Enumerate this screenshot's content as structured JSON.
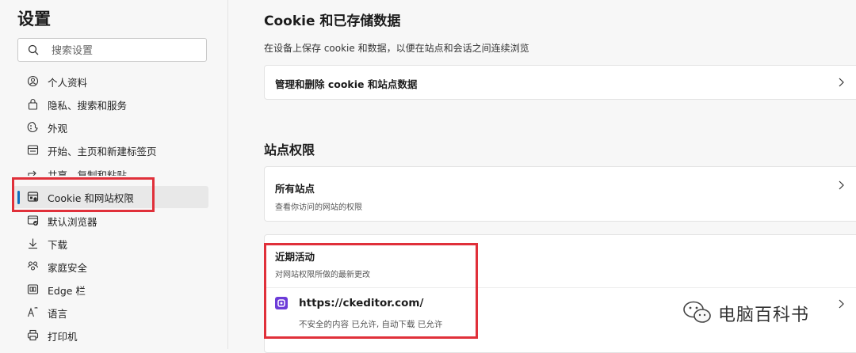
{
  "sidebar": {
    "title": "设置",
    "search_placeholder": "搜索设置",
    "items": [
      {
        "label": "个人资料",
        "icon": "profile-icon"
      },
      {
        "label": "隐私、搜索和服务",
        "icon": "lock-icon"
      },
      {
        "label": "外观",
        "icon": "appearance-icon"
      },
      {
        "label": "开始、主页和新建标签页",
        "icon": "start-page-icon"
      },
      {
        "label": "共享、复制和粘贴",
        "icon": "share-icon"
      },
      {
        "label": "Cookie 和网站权限",
        "icon": "cookie-permissions-icon",
        "active": true
      },
      {
        "label": "默认浏览器",
        "icon": "default-browser-icon"
      },
      {
        "label": "下载",
        "icon": "download-icon"
      },
      {
        "label": "家庭安全",
        "icon": "family-icon"
      },
      {
        "label": "Edge 栏",
        "icon": "edge-bar-icon"
      },
      {
        "label": "语言",
        "icon": "language-icon"
      },
      {
        "label": "打印机",
        "icon": "printer-icon"
      }
    ]
  },
  "main": {
    "cookie_section": {
      "title": "Cookie 和已存储数据",
      "description": "在设备上保存 cookie 和数据，以便在站点和会话之间连续浏览",
      "manage_label": "管理和删除 cookie 和站点数据"
    },
    "permissions_section": {
      "title": "站点权限",
      "all_sites_title": "所有站点",
      "all_sites_sub": "查看你访问的网站的权限",
      "recent_title": "近期活动",
      "recent_sub": "对网站权限所做的最新更改",
      "site_url": "https://ckeditor.com/",
      "site_detail": "不安全的内容 已允许, 自动下载 已允许"
    }
  },
  "watermark": {
    "text": "电脑百科书"
  },
  "colors": {
    "accent": "#0f6cbd",
    "highlight": "#e0303a",
    "site_icon": "#6c3bd8"
  }
}
